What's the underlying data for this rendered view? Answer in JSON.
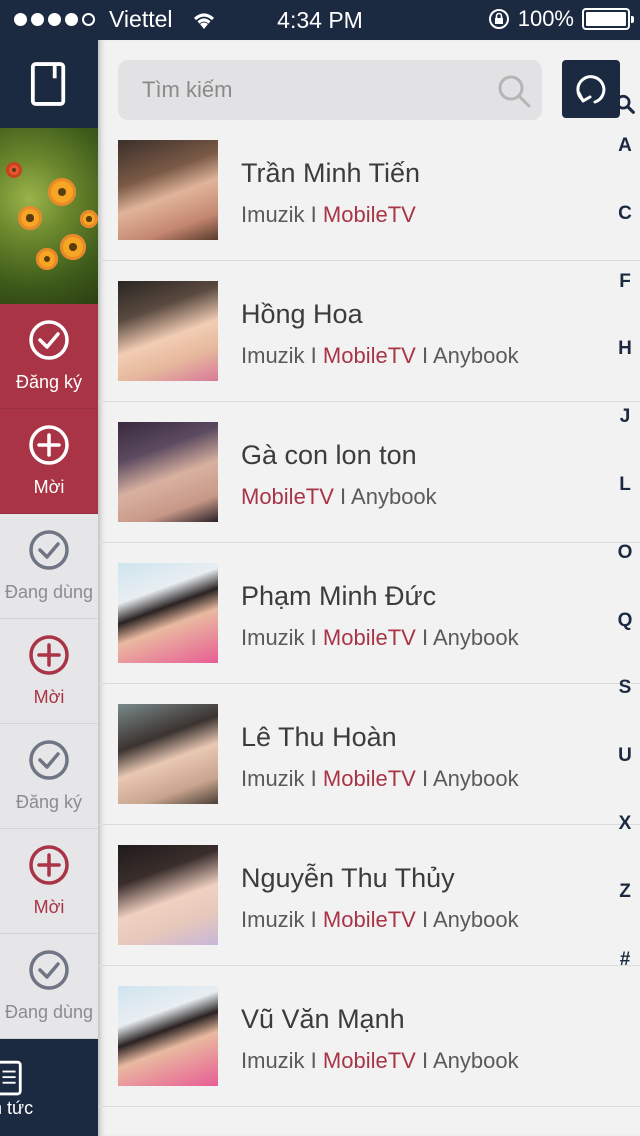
{
  "status_bar": {
    "carrier": "Viettel",
    "time": "4:34 PM",
    "battery": "100%",
    "battery_level": 1.0,
    "signal_dots_filled": 4,
    "signal_dots_total": 5
  },
  "sidebar": {
    "top_icon": "book-icon",
    "items": [
      {
        "label": "Đăng ký",
        "icon": "check-circle-icon",
        "style": "red"
      },
      {
        "label": "Mời",
        "icon": "plus-circle-icon",
        "style": "red"
      },
      {
        "label": "Đang dùng",
        "icon": "check-circle-icon",
        "style": "light"
      },
      {
        "label": "Mời",
        "icon": "plus-circle-icon",
        "style": "light-accent"
      },
      {
        "label": "Đăng ký",
        "icon": "check-circle-icon",
        "style": "light"
      },
      {
        "label": "Mời",
        "icon": "plus-circle-icon",
        "style": "light-accent"
      },
      {
        "label": "Đang dùng",
        "icon": "check-circle-icon",
        "style": "light"
      }
    ],
    "bottom_label": "n tức",
    "bottom_icon": "news-icon"
  },
  "search": {
    "placeholder": "Tìm kiếm",
    "icon": "search-icon"
  },
  "refresh_icon": "refresh-icon",
  "contacts": [
    {
      "name": "Trần Minh Tiến",
      "services": [
        "Imuzik",
        "MobileTV"
      ]
    },
    {
      "name": "Hồng Hoa",
      "services": [
        "Imuzik",
        "MobileTV",
        "Anybook"
      ]
    },
    {
      "name": "Gà con lon ton",
      "services": [
        "MobileTV",
        "Anybook"
      ]
    },
    {
      "name": "Phạm Minh Đức",
      "services": [
        "Imuzik",
        "MobileTV",
        "Anybook"
      ]
    },
    {
      "name": "Lê Thu Hoàn",
      "services": [
        "Imuzik",
        "MobileTV",
        "Anybook"
      ]
    },
    {
      "name": "Nguyễn Thu Thủy",
      "services": [
        "Imuzik",
        "MobileTV",
        "Anybook"
      ]
    },
    {
      "name": "Vũ Văn Mạnh",
      "services": [
        "Imuzik",
        "MobileTV",
        "Anybook"
      ]
    }
  ],
  "separator": " I ",
  "highlight_service": "MobileTV",
  "alphabet_index": [
    "A",
    "C",
    "F",
    "H",
    "J",
    "L",
    "O",
    "Q",
    "S",
    "U",
    "X",
    "Z",
    "#"
  ],
  "colors": {
    "navy": "#1b2a40",
    "accent_red": "#a83446",
    "light_gray": "#e6e6e9"
  }
}
